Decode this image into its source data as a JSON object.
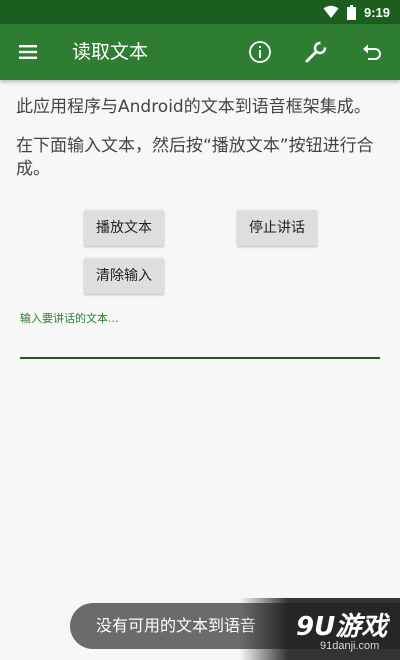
{
  "status_bar": {
    "time": "9:19"
  },
  "app_bar": {
    "title": "读取文本",
    "actions": [
      "info-icon",
      "wrench-icon",
      "undo-icon"
    ]
  },
  "content": {
    "intro": "此应用程序与Android的文本到语音框架集成。",
    "instruction": "在下面输入文本，然后按“播放文本”按钮进行合成。",
    "buttons": {
      "play": "播放文本",
      "stop": "停止讲话",
      "clear": "清除输入"
    },
    "input": {
      "placeholder": "输入要讲话的文本...",
      "value": ""
    }
  },
  "toast": {
    "message": "没有可用的文本到语音"
  },
  "watermark": {
    "logo": "9U游戏",
    "url": "91danji.com"
  },
  "colors": {
    "primary": "#2e7d32",
    "primary_dark": "#1b5e20",
    "toast": "#6b6b6b"
  }
}
